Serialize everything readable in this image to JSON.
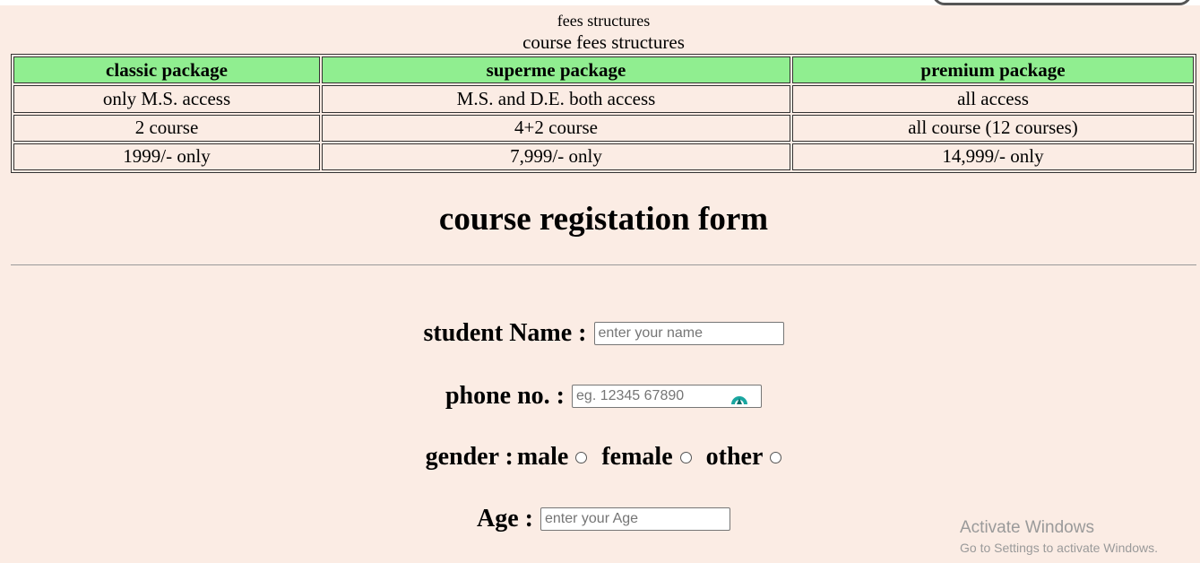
{
  "fees": {
    "caption_small": "fees structures",
    "caption_large": "course fees structures",
    "headers": [
      "classic package",
      "superme package",
      "premium package"
    ],
    "rows": [
      [
        "only M.S. access",
        "M.S. and D.E. both access",
        "all access"
      ],
      [
        "2 course",
        "4+2 course",
        "all course (12 courses)"
      ],
      [
        "1999/- only",
        "7,999/- only",
        "14,999/- only"
      ]
    ],
    "header_color": "#90ee90"
  },
  "form": {
    "title": "course registation form",
    "name_label": "student Name :",
    "name_placeholder": "enter your name",
    "phone_label": "phone no. :",
    "phone_placeholder": "eg. 12345 67890",
    "gender_label": "gender :",
    "gender_options": [
      "male",
      "female",
      "other"
    ],
    "age_label": "Age :",
    "age_placeholder": "enter your Age"
  },
  "watermark": {
    "line1": "Activate Windows",
    "line2": "Go to Settings to activate Windows."
  },
  "icons": {
    "phone_field_extension": "password-manager-icon"
  },
  "colors": {
    "background": "#fbece4",
    "table_header": "#90ee90",
    "icon_teal": "#1aa6a0"
  }
}
